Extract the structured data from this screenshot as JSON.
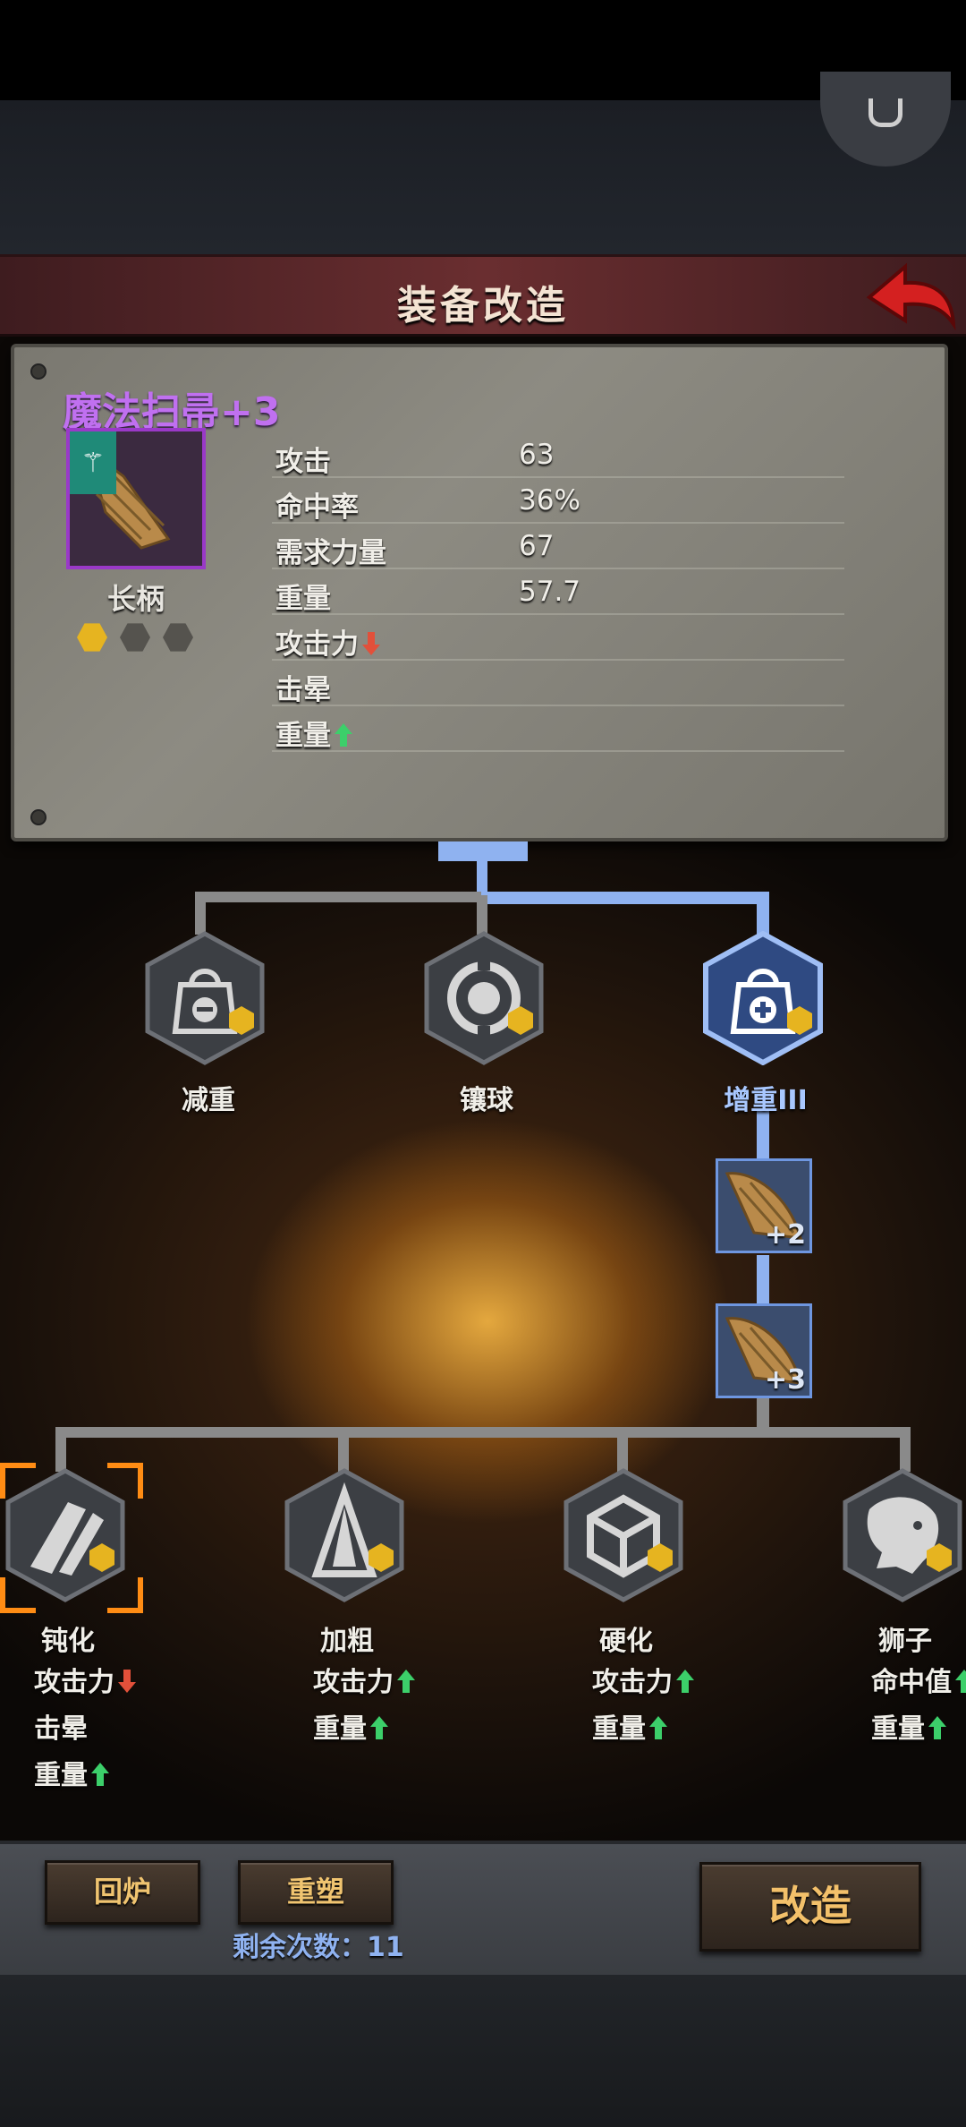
{
  "header": {
    "title": "装备改造",
    "back_icon": "back-arrow-icon",
    "corner_icon": "ghost-icon"
  },
  "item": {
    "name": "魔法扫帚+3",
    "type": "长柄",
    "gems_filled": 1,
    "gems_total": 3,
    "stats": [
      {
        "label": "攻击",
        "value": "63"
      },
      {
        "label": "命中率",
        "value": "36%"
      },
      {
        "label": "需求力量",
        "value": "67"
      },
      {
        "label": "重量",
        "value": "57.7"
      }
    ],
    "modifiers": [
      {
        "label": "攻击力",
        "direction": "down"
      },
      {
        "label": "击晕",
        "direction": "none"
      },
      {
        "label": "重量",
        "direction": "up"
      }
    ]
  },
  "tree": {
    "tier1": [
      {
        "label": "减重",
        "icon": "bag-minus-icon",
        "active": false
      },
      {
        "label": "镶球",
        "icon": "socket-ring-icon",
        "active": false
      },
      {
        "label": "增重III",
        "icon": "bag-plus-icon",
        "active": true
      }
    ],
    "upgrades": [
      "+2",
      "+3"
    ],
    "tier2": [
      {
        "label": "钝化",
        "icon": "blunt-claw-icon",
        "selected": true,
        "effects": [
          {
            "label": "攻击力",
            "direction": "down"
          },
          {
            "label": "击晕",
            "direction": "none"
          },
          {
            "label": "重量",
            "direction": "up"
          }
        ]
      },
      {
        "label": "加粗",
        "icon": "thick-spike-icon",
        "selected": false,
        "effects": [
          {
            "label": "攻击力",
            "direction": "up"
          },
          {
            "label": "重量",
            "direction": "up"
          }
        ]
      },
      {
        "label": "硬化",
        "icon": "cube-icon",
        "selected": false,
        "effects": [
          {
            "label": "攻击力",
            "direction": "up"
          },
          {
            "label": "重量",
            "direction": "up"
          }
        ]
      },
      {
        "label": "狮子",
        "icon": "lion-head-icon",
        "selected": false,
        "effects": [
          {
            "label": "命中值",
            "direction": "up"
          },
          {
            "label": "重量",
            "direction": "up"
          }
        ]
      }
    ]
  },
  "footer": {
    "smelt_label": "回炉",
    "reforge_label": "重塑",
    "remaining_label": "剩余次数：11",
    "modify_label": "改造"
  },
  "colors": {
    "accent_purple": "#c070f0",
    "path_blue": "#8fb2f0",
    "up_green": "#3ccf6a",
    "down_red": "#e2503a",
    "gem_gold": "#e6b420",
    "selection_orange": "#ff8c14"
  }
}
